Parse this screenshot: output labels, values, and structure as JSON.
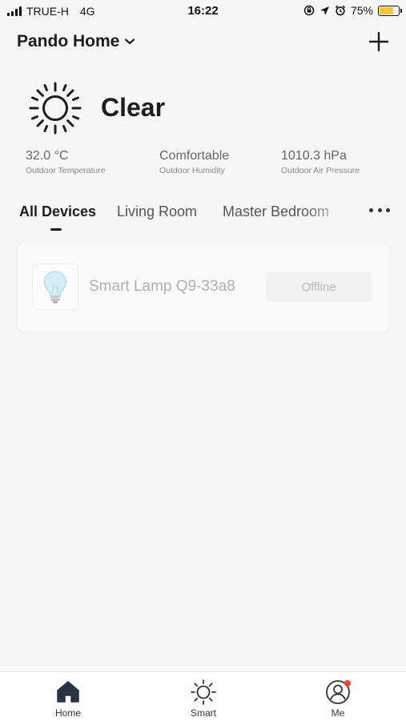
{
  "status_bar": {
    "carrier": "TRUE-H",
    "network": "4G",
    "time": "16:22",
    "battery": "75%",
    "battery_level": 0.75,
    "battery_color": "#f5c43d"
  },
  "header": {
    "home_name": "Pando Home"
  },
  "weather": {
    "icon": "sun-icon",
    "condition": "Clear",
    "stats": [
      {
        "value": "32.0 °C",
        "label": "Outdoor Temperature"
      },
      {
        "value": "Comfortable",
        "label": "Outdoor Humidity"
      },
      {
        "value": "1010.3 hPa",
        "label": "Outdoor Air Pressure"
      }
    ]
  },
  "tabs": [
    {
      "label": "All Devices",
      "active": true
    },
    {
      "label": "Living Room",
      "active": false
    },
    {
      "label": "Master Bedroom",
      "active": false
    }
  ],
  "devices": [
    {
      "name": "Smart Lamp Q9-33a8",
      "status": "Offline",
      "icon": "lightbulb-icon"
    }
  ],
  "bottom_nav": [
    {
      "label": "Home",
      "icon": "home-icon",
      "active": true
    },
    {
      "label": "Smart",
      "icon": "sun-icon",
      "active": false
    },
    {
      "label": "Me",
      "icon": "profile-icon",
      "active": false,
      "badge": true
    }
  ],
  "colors": {
    "background": "#f7f7f7",
    "accent": "#2b3245",
    "badge": "#e8452c"
  }
}
